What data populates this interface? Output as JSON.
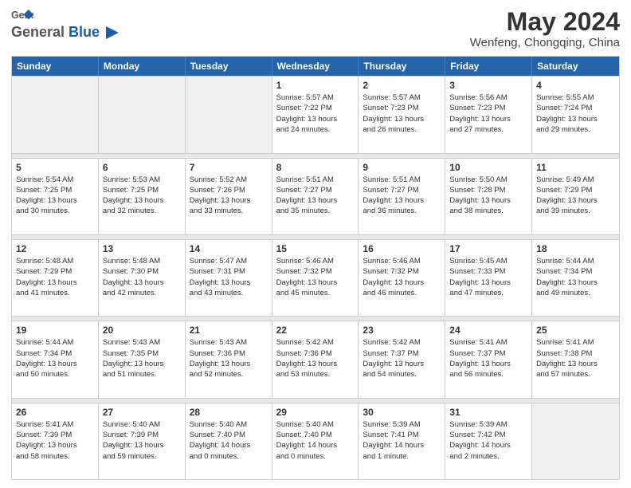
{
  "header": {
    "logo_general": "General",
    "logo_blue": "Blue",
    "month": "May 2024",
    "location": "Wenfeng, Chongqing, China"
  },
  "weekdays": [
    "Sunday",
    "Monday",
    "Tuesday",
    "Wednesday",
    "Thursday",
    "Friday",
    "Saturday"
  ],
  "rows": [
    [
      {
        "day": "",
        "lines": []
      },
      {
        "day": "",
        "lines": []
      },
      {
        "day": "",
        "lines": []
      },
      {
        "day": "1",
        "lines": [
          "Sunrise: 5:57 AM",
          "Sunset: 7:22 PM",
          "Daylight: 13 hours",
          "and 24 minutes."
        ]
      },
      {
        "day": "2",
        "lines": [
          "Sunrise: 5:57 AM",
          "Sunset: 7:23 PM",
          "Daylight: 13 hours",
          "and 26 minutes."
        ]
      },
      {
        "day": "3",
        "lines": [
          "Sunrise: 5:56 AM",
          "Sunset: 7:23 PM",
          "Daylight: 13 hours",
          "and 27 minutes."
        ]
      },
      {
        "day": "4",
        "lines": [
          "Sunrise: 5:55 AM",
          "Sunset: 7:24 PM",
          "Daylight: 13 hours",
          "and 29 minutes."
        ]
      }
    ],
    [
      {
        "day": "5",
        "lines": [
          "Sunrise: 5:54 AM",
          "Sunset: 7:25 PM",
          "Daylight: 13 hours",
          "and 30 minutes."
        ]
      },
      {
        "day": "6",
        "lines": [
          "Sunrise: 5:53 AM",
          "Sunset: 7:25 PM",
          "Daylight: 13 hours",
          "and 32 minutes."
        ]
      },
      {
        "day": "7",
        "lines": [
          "Sunrise: 5:52 AM",
          "Sunset: 7:26 PM",
          "Daylight: 13 hours",
          "and 33 minutes."
        ]
      },
      {
        "day": "8",
        "lines": [
          "Sunrise: 5:51 AM",
          "Sunset: 7:27 PM",
          "Daylight: 13 hours",
          "and 35 minutes."
        ]
      },
      {
        "day": "9",
        "lines": [
          "Sunrise: 5:51 AM",
          "Sunset: 7:27 PM",
          "Daylight: 13 hours",
          "and 36 minutes."
        ]
      },
      {
        "day": "10",
        "lines": [
          "Sunrise: 5:50 AM",
          "Sunset: 7:28 PM",
          "Daylight: 13 hours",
          "and 38 minutes."
        ]
      },
      {
        "day": "11",
        "lines": [
          "Sunrise: 5:49 AM",
          "Sunset: 7:29 PM",
          "Daylight: 13 hours",
          "and 39 minutes."
        ]
      }
    ],
    [
      {
        "day": "12",
        "lines": [
          "Sunrise: 5:48 AM",
          "Sunset: 7:29 PM",
          "Daylight: 13 hours",
          "and 41 minutes."
        ]
      },
      {
        "day": "13",
        "lines": [
          "Sunrise: 5:48 AM",
          "Sunset: 7:30 PM",
          "Daylight: 13 hours",
          "and 42 minutes."
        ]
      },
      {
        "day": "14",
        "lines": [
          "Sunrise: 5:47 AM",
          "Sunset: 7:31 PM",
          "Daylight: 13 hours",
          "and 43 minutes."
        ]
      },
      {
        "day": "15",
        "lines": [
          "Sunrise: 5:46 AM",
          "Sunset: 7:32 PM",
          "Daylight: 13 hours",
          "and 45 minutes."
        ]
      },
      {
        "day": "16",
        "lines": [
          "Sunrise: 5:46 AM",
          "Sunset: 7:32 PM",
          "Daylight: 13 hours",
          "and 46 minutes."
        ]
      },
      {
        "day": "17",
        "lines": [
          "Sunrise: 5:45 AM",
          "Sunset: 7:33 PM",
          "Daylight: 13 hours",
          "and 47 minutes."
        ]
      },
      {
        "day": "18",
        "lines": [
          "Sunrise: 5:44 AM",
          "Sunset: 7:34 PM",
          "Daylight: 13 hours",
          "and 49 minutes."
        ]
      }
    ],
    [
      {
        "day": "19",
        "lines": [
          "Sunrise: 5:44 AM",
          "Sunset: 7:34 PM",
          "Daylight: 13 hours",
          "and 50 minutes."
        ]
      },
      {
        "day": "20",
        "lines": [
          "Sunrise: 5:43 AM",
          "Sunset: 7:35 PM",
          "Daylight: 13 hours",
          "and 51 minutes."
        ]
      },
      {
        "day": "21",
        "lines": [
          "Sunrise: 5:43 AM",
          "Sunset: 7:36 PM",
          "Daylight: 13 hours",
          "and 52 minutes."
        ]
      },
      {
        "day": "22",
        "lines": [
          "Sunrise: 5:42 AM",
          "Sunset: 7:36 PM",
          "Daylight: 13 hours",
          "and 53 minutes."
        ]
      },
      {
        "day": "23",
        "lines": [
          "Sunrise: 5:42 AM",
          "Sunset: 7:37 PM",
          "Daylight: 13 hours",
          "and 54 minutes."
        ]
      },
      {
        "day": "24",
        "lines": [
          "Sunrise: 5:41 AM",
          "Sunset: 7:37 PM",
          "Daylight: 13 hours",
          "and 56 minutes."
        ]
      },
      {
        "day": "25",
        "lines": [
          "Sunrise: 5:41 AM",
          "Sunset: 7:38 PM",
          "Daylight: 13 hours",
          "and 57 minutes."
        ]
      }
    ],
    [
      {
        "day": "26",
        "lines": [
          "Sunrise: 5:41 AM",
          "Sunset: 7:39 PM",
          "Daylight: 13 hours",
          "and 58 minutes."
        ]
      },
      {
        "day": "27",
        "lines": [
          "Sunrise: 5:40 AM",
          "Sunset: 7:39 PM",
          "Daylight: 13 hours",
          "and 59 minutes."
        ]
      },
      {
        "day": "28",
        "lines": [
          "Sunrise: 5:40 AM",
          "Sunset: 7:40 PM",
          "Daylight: 14 hours",
          "and 0 minutes."
        ]
      },
      {
        "day": "29",
        "lines": [
          "Sunrise: 5:40 AM",
          "Sunset: 7:40 PM",
          "Daylight: 14 hours",
          "and 0 minutes."
        ]
      },
      {
        "day": "30",
        "lines": [
          "Sunrise: 5:39 AM",
          "Sunset: 7:41 PM",
          "Daylight: 14 hours",
          "and 1 minute."
        ]
      },
      {
        "day": "31",
        "lines": [
          "Sunrise: 5:39 AM",
          "Sunset: 7:42 PM",
          "Daylight: 14 hours",
          "and 2 minutes."
        ]
      },
      {
        "day": "",
        "lines": []
      }
    ]
  ]
}
